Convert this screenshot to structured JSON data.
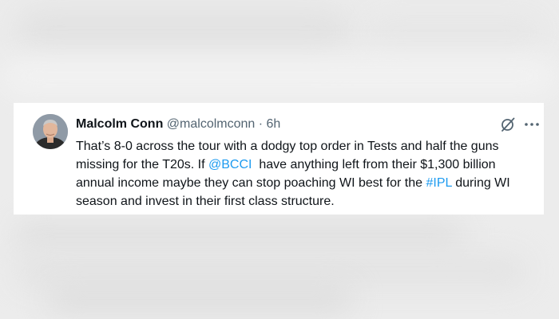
{
  "tweet": {
    "author_name": "Malcolm Conn",
    "handle": "@malcolmconn",
    "separator": " · ",
    "time": "6h",
    "text_part1": "That’s 8-0 across the tour with a dodgy top order in Tests and half the guns missing for the T20s. If ",
    "mention": "@BCCI",
    "text_part2": "  have anything left from their $1,300 billion annual income maybe they can stop poaching WI best for the ",
    "hashtag": "#IPL",
    "text_part3": " during WI season and invest in their first class structure.",
    "icons": [
      "grok-icon",
      "more-icon"
    ],
    "link_color": "#1d9bf0"
  }
}
